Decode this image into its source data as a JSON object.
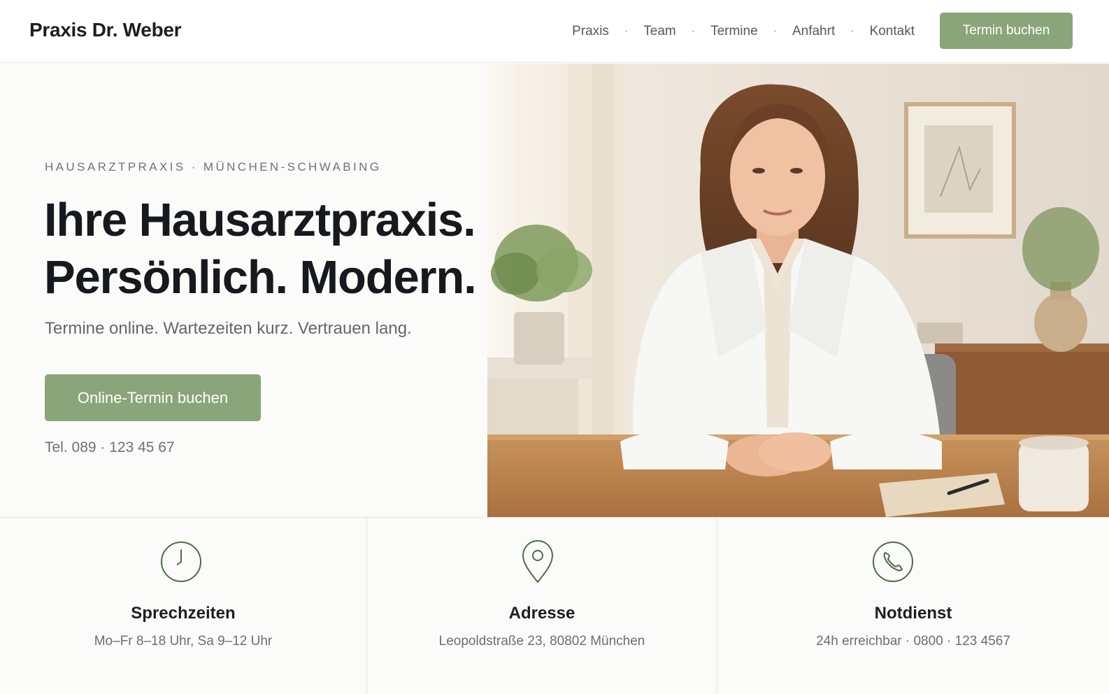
{
  "header": {
    "brand": "Praxis Dr. Weber",
    "nav": [
      {
        "label": "Praxis"
      },
      {
        "label": "Team"
      },
      {
        "label": "Termine"
      },
      {
        "label": "Anfahrt"
      },
      {
        "label": "Kontakt"
      }
    ],
    "nav_separator": "·",
    "cta_label": "Termin buchen"
  },
  "hero": {
    "eyebrow": "HAUSARZTPRAXIS · MÜNCHEN-SCHWABING",
    "headline_line1": "Ihre Hausarztpraxis.",
    "headline_line2": "Persönlich. Modern.",
    "subline": "Termine online. Wartezeiten kurz. Vertrauen lang.",
    "cta_label": "Online-Termin buchen",
    "phone": "Tel. 089 · 123 45 67"
  },
  "info_cards": [
    {
      "icon": "clock-icon",
      "title": "Sprechzeiten",
      "text": "Mo–Fr 8–18 Uhr, Sa 9–12 Uhr"
    },
    {
      "icon": "map-pin-icon",
      "title": "Adresse",
      "text": "Leopoldstraße 23, 80802 München"
    },
    {
      "icon": "phone-icon",
      "title": "Notdienst",
      "text": "24h erreichbar · 0800 · 123 4567"
    }
  ],
  "colors": {
    "accent": "#8ba57a",
    "icon_stroke": "#4f6b45",
    "text_dark": "#16191e",
    "text_muted": "#63676c"
  }
}
